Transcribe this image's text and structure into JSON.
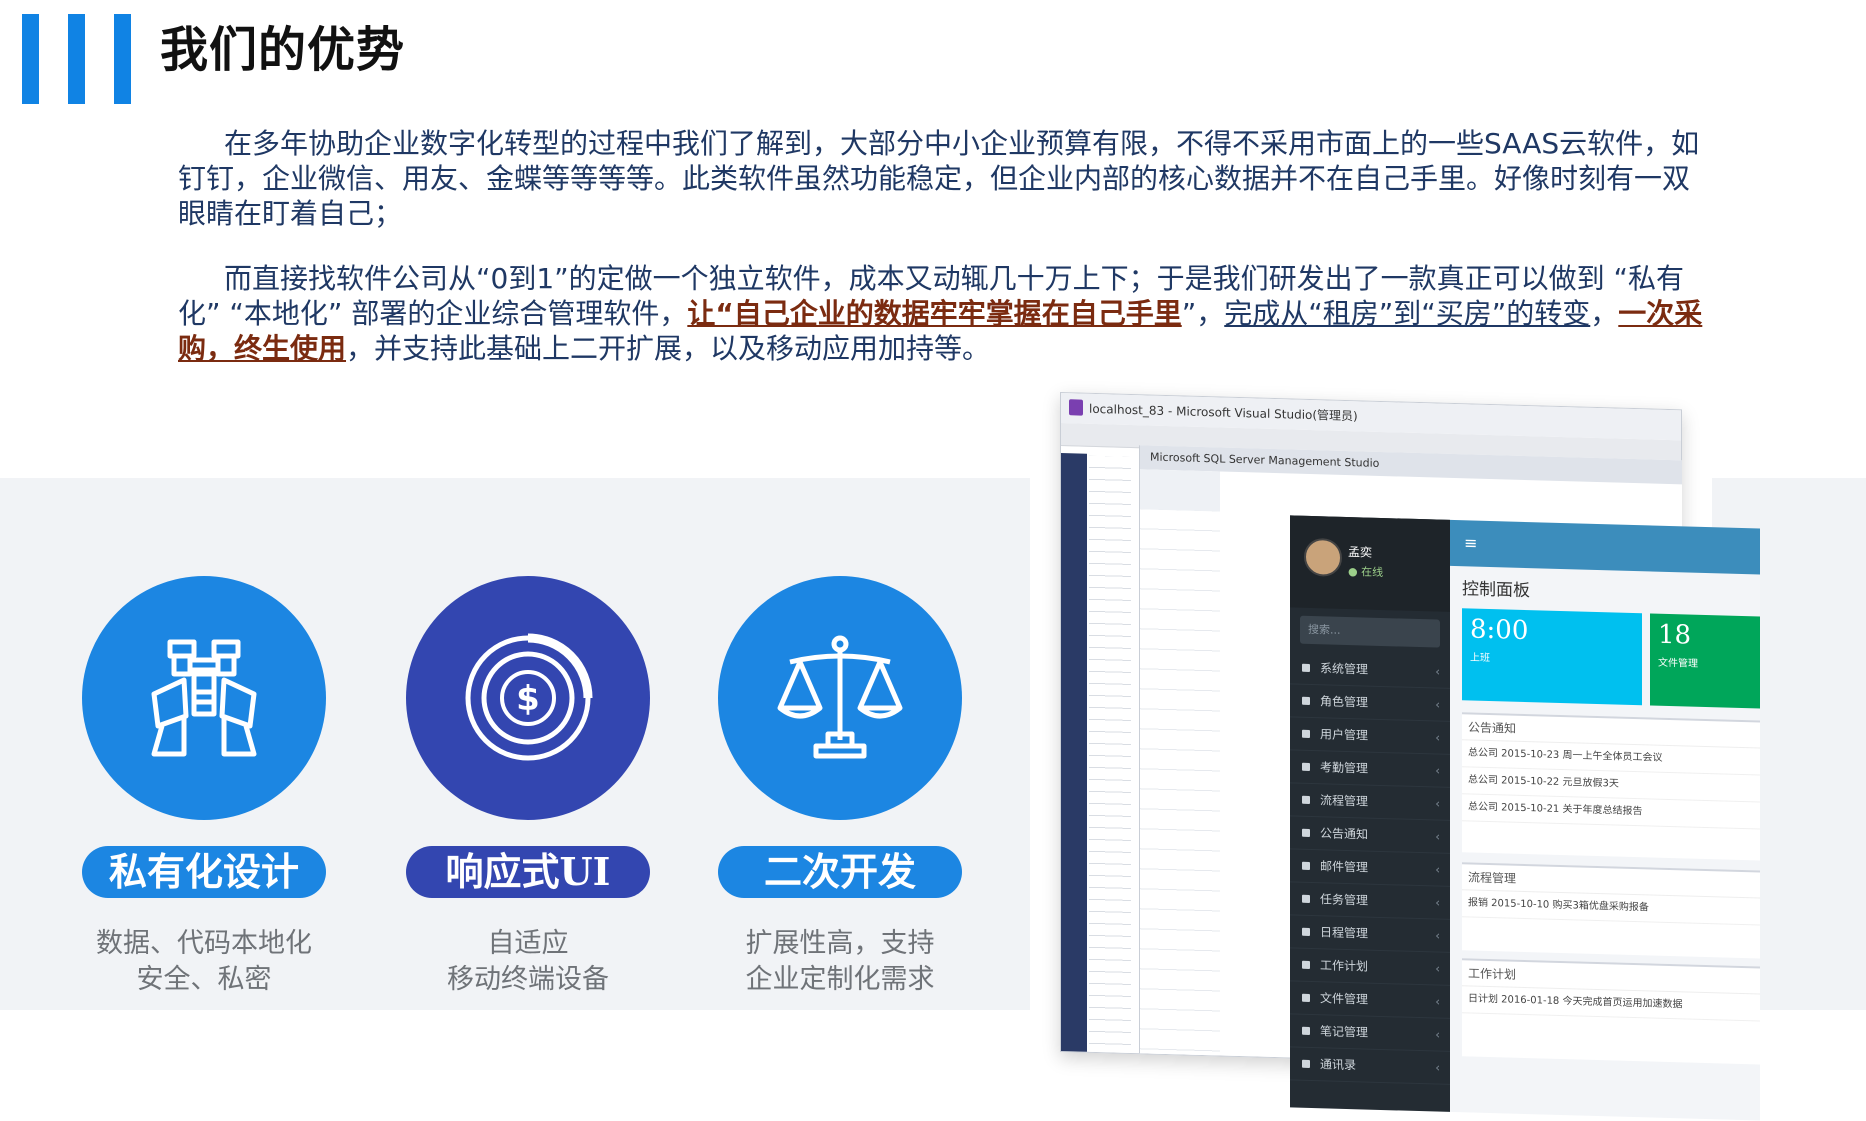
{
  "header": {
    "title": "我们的优势"
  },
  "intro": {
    "p1": "在多年协助企业数字化转型的过程中我们了解到，大部分中小企业预算有限，不得不采用市面上的一些SAAS云软件，如钉钉，企业微信、用友、金蝶等等等等。此类软件虽然功能稳定，但企业内部的核心数据并不在自己手里。好像时刻有一双眼睛在盯着自己；",
    "p2_a": "而直接找软件公司从“0到1”的定做一个独立软件，成本又动辄几十万上下；于是我们研发出了一款真正可以做到 “私有化” “本地化” 部署的企业综合管理软件，",
    "p2_hl1": "让“自己企业的数据牢牢掌握在自己手里",
    "p2_b": "”，",
    "p2_hl2": "完成从“租房”到“买房”的转变",
    "p2_c": "，",
    "p2_hl3": "一次采购，终生使用",
    "p2_d": "，并支持此基础上二开扩展，以及移动应用加持等。"
  },
  "features": [
    {
      "title": "私有化设计",
      "desc_line1": "数据、代码本地化",
      "desc_line2": "安全、私密",
      "icon": "binoculars-icon"
    },
    {
      "title": "响应式UI",
      "desc_line1": "自适应",
      "desc_line2": "移动终端设备",
      "icon": "coin-target-icon"
    },
    {
      "title": "二次开发",
      "desc_line1": "扩展性高，支持",
      "desc_line2": "企业定制化需求",
      "icon": "scales-icon"
    }
  ],
  "screenshot": {
    "vs_title": "localhost_83 - Microsoft Visual Studio(管理员)",
    "sql_title": "Microsoft SQL Server Management Studio",
    "user_name": "孟奕",
    "user_status": "● 在线",
    "search_placeholder": "搜索...",
    "menu": [
      "系统管理",
      "角色管理",
      "用户管理",
      "考勤管理",
      "流程管理",
      "公告通知",
      "邮件管理",
      "任务管理",
      "日程管理",
      "工作计划",
      "文件管理",
      "笔记管理",
      "通讯录"
    ],
    "dashboard_title": "控制面板",
    "tile_a_big": "8:00",
    "tile_a_small": "上班",
    "tile_b_big": "18",
    "tile_b_small": "文件管理",
    "panel1_title": "公告通知",
    "panel1_rows": [
      "总公司  2015-10-23  周一上午全体员工会议",
      "总公司  2015-10-22  元旦放假3天",
      "总公司  2015-10-21  关于年度总结报告"
    ],
    "panel2_title": "流程管理",
    "panel2_rows": [
      "报销  2015-10-10  购买3箱优盘采购报备"
    ],
    "panel3_title": "工作计划",
    "panel3_rows": [
      "日计划  2016-01-18  今天完成首页运用加速数据"
    ]
  }
}
